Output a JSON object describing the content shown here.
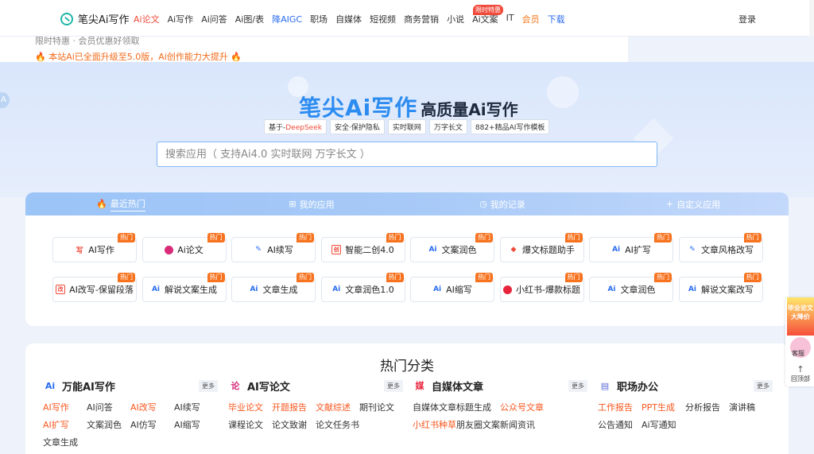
{
  "header": {
    "logo_text": "笔尖Ai写作",
    "nav": [
      {
        "label": "Ai论文",
        "style": "red"
      },
      {
        "label": "Ai写作",
        "style": ""
      },
      {
        "label": "Ai问答",
        "style": ""
      },
      {
        "label": "Ai图/表",
        "style": ""
      },
      {
        "label": "降AIGC",
        "style": "blue"
      },
      {
        "label": "职场",
        "style": ""
      },
      {
        "label": "自媒体",
        "style": ""
      },
      {
        "label": "短视频",
        "style": ""
      },
      {
        "label": "商务营销",
        "style": ""
      },
      {
        "label": "小说",
        "style": ""
      },
      {
        "label": "Ai文案",
        "style": ""
      },
      {
        "label": "IT",
        "style": ""
      },
      {
        "label": "会员",
        "style": "orange"
      },
      {
        "label": "下载",
        "style": "blue"
      }
    ],
    "limited_badge": "限时特惠",
    "login": "登录"
  },
  "notice": {
    "line1": "限时特惠 · 会员优惠好领取",
    "line2": "🔥 本站Ai已全面升级至5.0版，Ai创作能力大提升 🔥"
  },
  "hero": {
    "title_big": "笔尖Ai写作",
    "title_sub": "高质量Ai写作",
    "tags": [
      "基于-DeepSeek",
      "安全·保护隐私",
      "实时联网",
      "万字长文",
      "882+精品AI写作模板"
    ],
    "side_letter": "A",
    "search_placeholder": "搜索应用（ 支持Ai4.0 实时联网 万字长文 ）"
  },
  "tabs": [
    {
      "icon": "fire-icon",
      "glyph": "🔥",
      "label": "最近热门",
      "active": true
    },
    {
      "icon": "grid-icon",
      "glyph": "⊞",
      "label": "我的应用",
      "active": false
    },
    {
      "icon": "clock-icon",
      "glyph": "◷",
      "label": "我的记录",
      "active": false
    },
    {
      "icon": "plus-icon",
      "glyph": "+",
      "label": "自定义应用",
      "active": false
    }
  ],
  "hot_label": "热门",
  "apps": [
    {
      "label": "AI写作",
      "icon": "pen-icon",
      "glyph": "写",
      "cls": "red"
    },
    {
      "label": "Ai论文",
      "icon": "paper-icon",
      "glyph": "",
      "cls": "pinkdot"
    },
    {
      "label": "AI续写",
      "icon": "continue-icon",
      "glyph": "✎",
      "cls": ""
    },
    {
      "label": "智能二创4.0",
      "icon": "recreate-icon",
      "glyph": "创",
      "cls": "box red"
    },
    {
      "label": "文案润色",
      "icon": "ai-icon",
      "glyph": "Ai",
      "cls": ""
    },
    {
      "label": "爆文标题助手",
      "icon": "title-icon",
      "glyph": "◆",
      "cls": "red"
    },
    {
      "label": "AI扩写",
      "icon": "ai-icon",
      "glyph": "Ai",
      "cls": ""
    },
    {
      "label": "文章风格改写",
      "icon": "edit-icon",
      "glyph": "✎",
      "cls": ""
    },
    {
      "label": "AI改写-保留段落",
      "icon": "rewrite-icon",
      "glyph": "改",
      "cls": "box red"
    },
    {
      "label": "解说文案生成",
      "icon": "ai-icon",
      "glyph": "Ai",
      "cls": ""
    },
    {
      "label": "文章生成",
      "icon": "ai-icon",
      "glyph": "Ai",
      "cls": ""
    },
    {
      "label": "文章润色1.0",
      "icon": "ai-icon",
      "glyph": "Ai",
      "cls": ""
    },
    {
      "label": "AI缩写",
      "icon": "ai-icon",
      "glyph": "Ai",
      "cls": ""
    },
    {
      "label": "小红书-爆款标题",
      "icon": "xiaohongshu-icon",
      "glyph": "",
      "cls": "xhs"
    },
    {
      "label": "文章润色",
      "icon": "ai-icon",
      "glyph": "Ai",
      "cls": ""
    },
    {
      "label": "解说文案改写",
      "icon": "ai-icon",
      "glyph": "Ai",
      "cls": ""
    }
  ],
  "categories": {
    "title": "热门分类",
    "more": "更多",
    "columns": [
      {
        "head": "万能AI写作",
        "icon": "ai-icon",
        "items": [
          {
            "t": "AI写作",
            "r": true
          },
          {
            "t": "AI问答",
            "r": false
          },
          {
            "t": "AI改写",
            "r": true
          },
          {
            "t": "AI续写",
            "r": false
          },
          {
            "t": "AI扩写",
            "r": true
          },
          {
            "t": "文案润色",
            "r": false
          },
          {
            "t": "AI仿写",
            "r": false
          },
          {
            "t": "AI缩写",
            "r": false
          },
          {
            "t": "文章生成",
            "r": false
          }
        ]
      },
      {
        "head": "AI写论文",
        "icon": "paper-icon",
        "items": [
          {
            "t": "毕业论文",
            "r": true
          },
          {
            "t": "开题报告",
            "r": true
          },
          {
            "t": "文献综述",
            "r": true
          },
          {
            "t": "期刊论文",
            "r": false
          },
          {
            "t": "课程论文",
            "r": false
          },
          {
            "t": "论文致谢",
            "r": false
          },
          {
            "t": "论文任务书",
            "r": false
          }
        ]
      },
      {
        "head": "自媒体文章",
        "icon": "media-icon",
        "items": [
          {
            "t": "自媒体文章",
            "r": false
          },
          {
            "t": "标题生成",
            "r": false
          },
          {
            "t": "公众号文章",
            "r": true
          },
          {
            "t": "",
            "r": false
          },
          {
            "t": "小红书种草",
            "r": true
          },
          {
            "t": "朋友圈文案",
            "r": false
          },
          {
            "t": "新闻资讯",
            "r": false
          }
        ]
      },
      {
        "head": "职场办公",
        "icon": "office-icon",
        "items": [
          {
            "t": "工作报告",
            "r": true
          },
          {
            "t": "PPT生成",
            "r": true
          },
          {
            "t": "分析报告",
            "r": false
          },
          {
            "t": "演讲稿",
            "r": false
          },
          {
            "t": "公告通知",
            "r": false
          },
          {
            "t": "Ai写通知",
            "r": false
          }
        ]
      }
    ]
  },
  "float": {
    "ad_text": "毕业论文大降价",
    "kefu": "客服",
    "top": "回顶部"
  }
}
